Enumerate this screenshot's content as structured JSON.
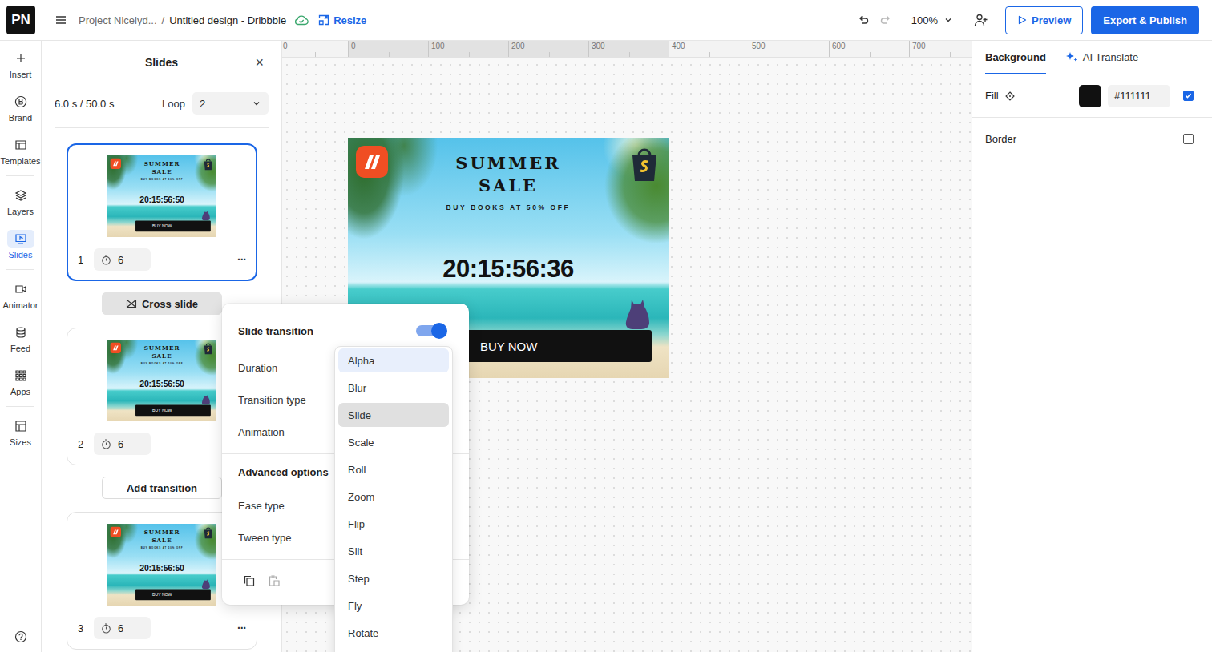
{
  "topbar": {
    "logo": "PN",
    "project": "Project Nicelyd...",
    "separator": "/",
    "design_name": "Untitled design - Dribbble",
    "resize": "Resize",
    "zoom": "100%",
    "redo_disabled": true,
    "preview": "Preview",
    "export": "Export & Publish"
  },
  "rail": {
    "groups": [
      [
        {
          "label": "Insert",
          "selected": false
        },
        {
          "label": "Brand",
          "selected": false
        },
        {
          "label": "Templates",
          "selected": false
        }
      ],
      [
        {
          "label": "Layers",
          "selected": false
        },
        {
          "label": "Slides",
          "selected": true
        }
      ],
      [
        {
          "label": "Animator",
          "selected": false
        },
        {
          "label": "Feed",
          "selected": false
        },
        {
          "label": "Apps",
          "selected": false
        }
      ],
      [
        {
          "label": "Sizes",
          "selected": false
        }
      ]
    ]
  },
  "slides_panel": {
    "title": "Slides",
    "close": "×",
    "time": "6.0 s / 50.0 s",
    "loop_label": "Loop",
    "loop_value": "2",
    "slides": [
      {
        "number": "1",
        "duration": "6",
        "selected": true,
        "menu": "···",
        "timer": "20:15:56:50",
        "transition": {
          "label": "Cross slide",
          "active": true
        }
      },
      {
        "number": "2",
        "duration": "6",
        "selected": false,
        "timer": "20:15:56:50",
        "transition": {
          "label": "Add transition",
          "active": false
        }
      },
      {
        "number": "3",
        "duration": "6",
        "selected": false,
        "menu": "···",
        "timer": "20:15:56:50"
      }
    ]
  },
  "canvas": {
    "ruler": [
      {
        "label": "0",
        "in_design": false
      },
      {
        "label": "0",
        "in_design": true
      },
      {
        "label": "100",
        "in_design": true
      },
      {
        "label": "200",
        "in_design": true
      },
      {
        "label": "300",
        "in_design": true
      },
      {
        "label": "400",
        "in_design": false
      },
      {
        "label": "500",
        "in_design": false
      },
      {
        "label": "600",
        "in_design": false
      },
      {
        "label": "700",
        "in_design": false
      }
    ],
    "design": {
      "title_lines": [
        "SUMMER",
        "SALE"
      ],
      "subtitle": "BUY BOOKS AT 50% OFF",
      "timer": "20:15:56:36",
      "button": "BUY NOW"
    }
  },
  "popover": {
    "title": "Slide transition",
    "enabled": true,
    "rows": [
      "Duration",
      "Transition type",
      "Animation"
    ],
    "advanced_title": "Advanced options",
    "advanced_rows": [
      "Ease type",
      "Tween type"
    ],
    "dropdown": [
      {
        "label": "Alpha",
        "selected": false,
        "highlighted": true
      },
      {
        "label": "Blur",
        "selected": false,
        "highlighted": false
      },
      {
        "label": "Slide",
        "selected": true,
        "highlighted": false
      },
      {
        "label": "Scale",
        "selected": false,
        "highlighted": false
      },
      {
        "label": "Roll",
        "selected": false,
        "highlighted": false
      },
      {
        "label": "Zoom",
        "selected": false,
        "highlighted": false
      },
      {
        "label": "Flip",
        "selected": false,
        "highlighted": false
      },
      {
        "label": "Slit",
        "selected": false,
        "highlighted": false
      },
      {
        "label": "Step",
        "selected": false,
        "highlighted": false
      },
      {
        "label": "Fly",
        "selected": false,
        "highlighted": false
      },
      {
        "label": "Rotate",
        "selected": false,
        "highlighted": false
      }
    ]
  },
  "right_panel": {
    "tabs": [
      {
        "label": "Background",
        "selected": true
      },
      {
        "label": "AI Translate",
        "selected": false
      }
    ],
    "fill": {
      "label": "Fill",
      "value": "#111111",
      "enabled": true
    },
    "border": {
      "label": "Border",
      "enabled": false
    }
  }
}
